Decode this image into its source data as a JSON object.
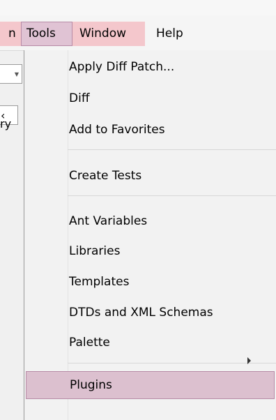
{
  "menubar": {
    "left_fragment": "n",
    "tools": "Tools",
    "window": "Window",
    "help": "Help"
  },
  "background": {
    "stub_text": "‹",
    "stub_suffix": "ry"
  },
  "tools_menu": {
    "items": [
      {
        "label": "Apply Diff Patch..."
      },
      {
        "label": "Diff"
      },
      {
        "label": "Add to Favorites"
      },
      {
        "label": "Create Tests"
      },
      {
        "label": "Ant Variables"
      },
      {
        "label": "Libraries"
      },
      {
        "label": "Templates"
      },
      {
        "label": "DTDs and XML Schemas"
      },
      {
        "label": "Palette",
        "has_submenu": true
      },
      {
        "label": "Plugins",
        "highlighted": true
      }
    ]
  },
  "colors": {
    "highlight_fill": "#dcc0cf",
    "highlight_border": "#b78aa6",
    "pink_highlight": "#f4c7cc"
  }
}
